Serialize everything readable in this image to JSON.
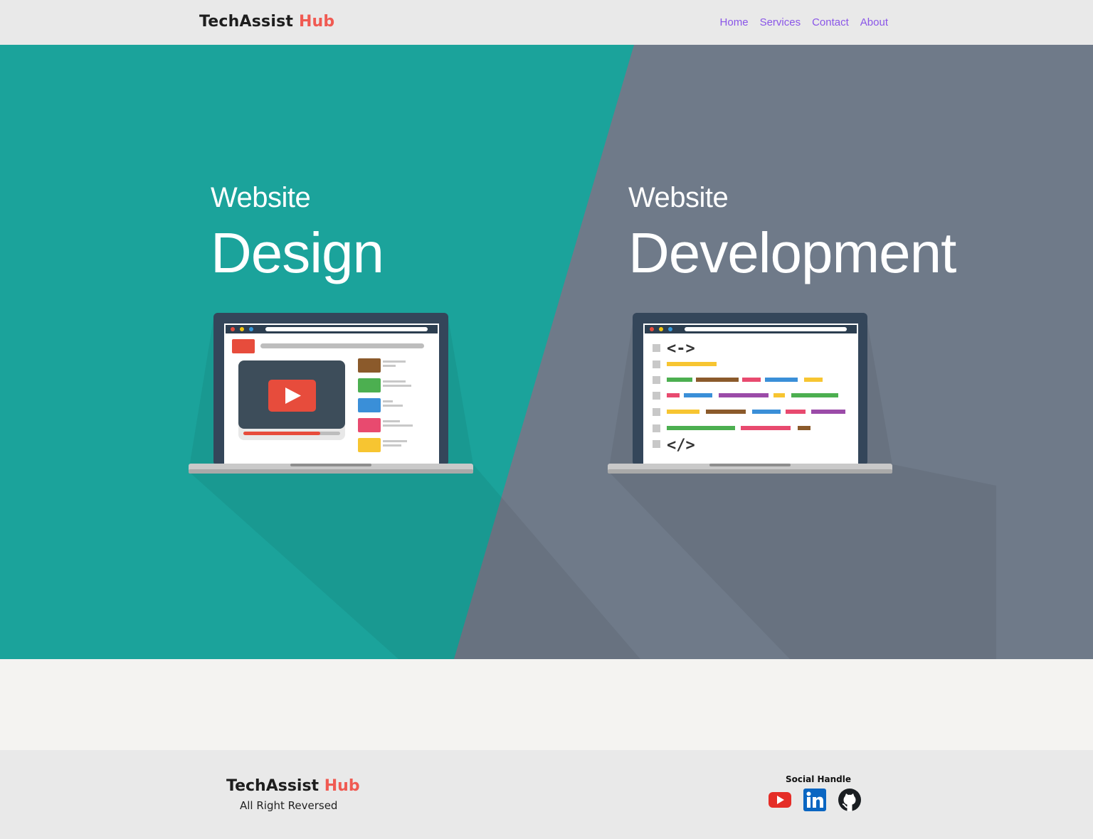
{
  "header": {
    "brand_main": "TechAssist",
    "brand_accent": "Hub",
    "nav": [
      {
        "label": "Home"
      },
      {
        "label": "Services"
      },
      {
        "label": "Contact"
      },
      {
        "label": "About"
      }
    ]
  },
  "hero": {
    "design": {
      "small": "Website",
      "big": "Design",
      "color": "#1ba39b"
    },
    "development": {
      "small": "Website",
      "big": "Development",
      "color": "#6f7a89"
    }
  },
  "footer": {
    "brand_main": "TechAssist",
    "brand_accent": "Hub",
    "copyright": "All Right Reversed",
    "social_title": "Social Handle",
    "socials": [
      {
        "icon": "youtube-icon",
        "color": "#e52d27"
      },
      {
        "icon": "linkedin-icon",
        "color": "#0a66c2"
      },
      {
        "icon": "github-icon",
        "color": "#1b1f23"
      }
    ]
  }
}
